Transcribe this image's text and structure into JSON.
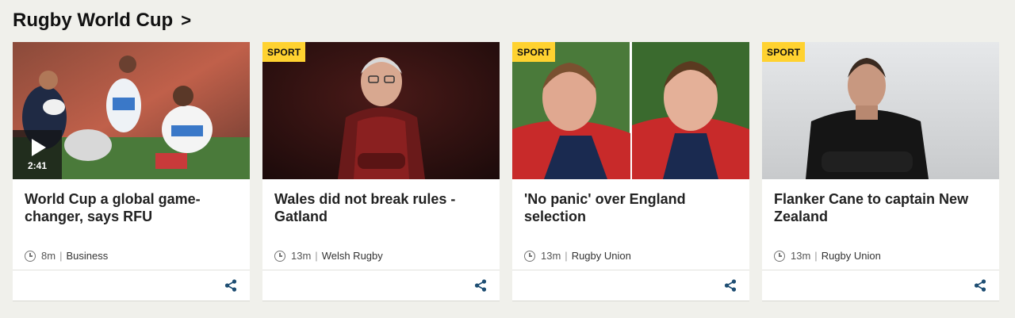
{
  "section": {
    "title": "Rugby World Cup",
    "chevron": ">"
  },
  "cards": [
    {
      "headline": "World Cup a global game-changer, says RFU",
      "time": "8m",
      "category": "Business",
      "video_duration": "2:41",
      "icon": "play-icon"
    },
    {
      "tag": "SPORT",
      "headline": "Wales did not break rules - Gatland",
      "time": "13m",
      "category": "Welsh Rugby"
    },
    {
      "tag": "SPORT",
      "headline": "'No panic' over England selection",
      "time": "13m",
      "category": "Rugby Union"
    },
    {
      "tag": "SPORT",
      "headline": "Flanker Cane to captain New Zealand",
      "time": "13m",
      "category": "Rugby Union"
    }
  ],
  "colors": {
    "background": "#f0f0eb",
    "tag": "#ffd230",
    "share_icon": "#1f4e73"
  }
}
